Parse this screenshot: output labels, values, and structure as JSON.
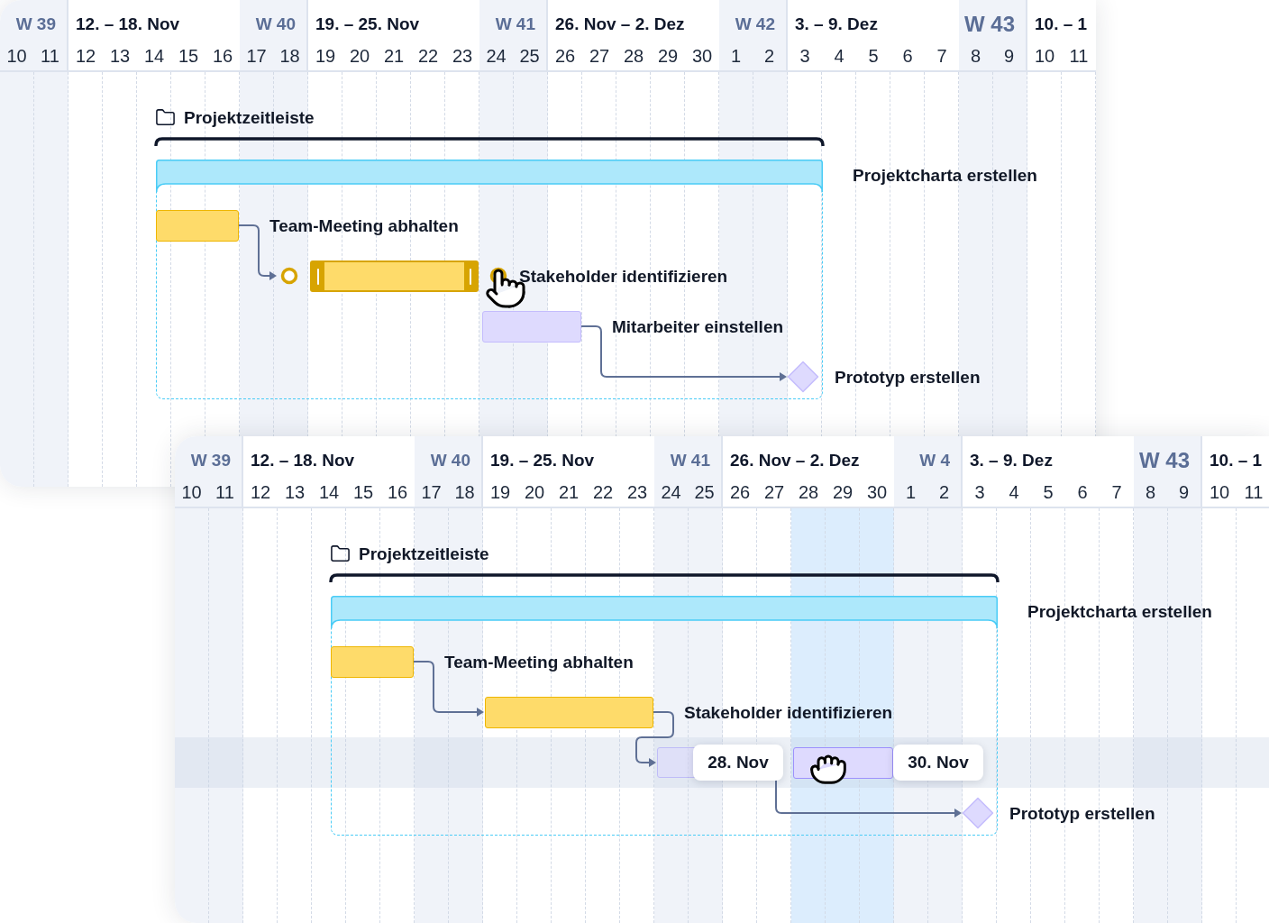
{
  "panels": [
    {
      "weeks": [
        {
          "kind": "weekend",
          "label": "W 39",
          "large": false,
          "days": [
            {
              "label": "10",
              "highlighted": false
            },
            {
              "label": "11",
              "highlighted": false
            }
          ]
        },
        {
          "kind": "weekdays",
          "label": "12. – 18. Nov",
          "large": false,
          "days": [
            {
              "label": "12",
              "highlighted": false
            },
            {
              "label": "13",
              "highlighted": false
            },
            {
              "label": "14",
              "highlighted": false
            },
            {
              "label": "15",
              "highlighted": false
            },
            {
              "label": "16",
              "highlighted": false
            }
          ]
        },
        {
          "kind": "weekend",
          "label": "W 40",
          "large": false,
          "days": [
            {
              "label": "17",
              "highlighted": false
            },
            {
              "label": "18",
              "highlighted": false
            }
          ]
        },
        {
          "kind": "weekdays",
          "label": "19. – 25. Nov",
          "large": false,
          "days": [
            {
              "label": "19",
              "highlighted": false
            },
            {
              "label": "20",
              "highlighted": false
            },
            {
              "label": "21",
              "highlighted": false
            },
            {
              "label": "22",
              "highlighted": false
            },
            {
              "label": "23",
              "highlighted": false
            }
          ]
        },
        {
          "kind": "weekend",
          "label": "W 41",
          "large": false,
          "days": [
            {
              "label": "24",
              "highlighted": false
            },
            {
              "label": "25",
              "highlighted": false
            }
          ]
        },
        {
          "kind": "weekdays",
          "label": "26. Nov – 2. Dez",
          "large": false,
          "days": [
            {
              "label": "26",
              "highlighted": false
            },
            {
              "label": "27",
              "highlighted": false
            },
            {
              "label": "28",
              "highlighted": false
            },
            {
              "label": "29",
              "highlighted": false
            },
            {
              "label": "30",
              "highlighted": false
            }
          ]
        },
        {
          "kind": "weekend",
          "label": "W 42",
          "large": false,
          "days": [
            {
              "label": "1",
              "highlighted": false
            },
            {
              "label": "2",
              "highlighted": false
            }
          ]
        },
        {
          "kind": "weekdays",
          "label": "3. – 9. Dez",
          "large": false,
          "days": [
            {
              "label": "3",
              "highlighted": false
            },
            {
              "label": "4",
              "highlighted": false
            },
            {
              "label": "5",
              "highlighted": false
            },
            {
              "label": "6",
              "highlighted": false
            },
            {
              "label": "7",
              "highlighted": false
            }
          ]
        },
        {
          "kind": "weekend",
          "label": "W 43",
          "large": true,
          "days": [
            {
              "label": "8",
              "highlighted": false
            },
            {
              "label": "9",
              "highlighted": false
            }
          ]
        },
        {
          "kind": "weekdays",
          "label": "10. – 1",
          "large": false,
          "days": [
            {
              "label": "10",
              "highlighted": false
            },
            {
              "label": "11",
              "highlighted": false
            }
          ]
        }
      ],
      "project": {
        "title": "Projektzeitleiste"
      },
      "tasks": [
        {
          "kind": "summary",
          "label": "Projektcharta erstellen",
          "color": "#ade8fb"
        },
        {
          "kind": "task",
          "label": "Team-Meeting abhalten",
          "color": "#fedb6a",
          "selected": false,
          "dragging": false,
          "linked": true
        },
        {
          "kind": "task",
          "label": "Stakeholder identifizieren",
          "color": "#fedb6a",
          "selected": true,
          "dragging": false,
          "linked": false
        },
        {
          "kind": "task",
          "label": "Mitarbeiter einstellen",
          "color": "#dedafe",
          "selected": false,
          "dragging": false,
          "linked": true
        },
        {
          "kind": "milestone",
          "label": "Prototyp erstellen",
          "color": "#dedafe"
        }
      ]
    },
    {
      "weeks": [
        {
          "kind": "weekend",
          "label": "W 39",
          "large": false,
          "days": [
            {
              "label": "10",
              "highlighted": false
            },
            {
              "label": "11",
              "highlighted": false
            }
          ]
        },
        {
          "kind": "weekdays",
          "label": "12. – 18. Nov",
          "large": false,
          "days": [
            {
              "label": "12",
              "highlighted": false
            },
            {
              "label": "13",
              "highlighted": false
            },
            {
              "label": "14",
              "highlighted": false
            },
            {
              "label": "15",
              "highlighted": false
            },
            {
              "label": "16",
              "highlighted": false
            }
          ]
        },
        {
          "kind": "weekend",
          "label": "W 40",
          "large": false,
          "days": [
            {
              "label": "17",
              "highlighted": false
            },
            {
              "label": "18",
              "highlighted": false
            }
          ]
        },
        {
          "kind": "weekdays",
          "label": "19. – 25. Nov",
          "large": false,
          "days": [
            {
              "label": "19",
              "highlighted": false
            },
            {
              "label": "20",
              "highlighted": false
            },
            {
              "label": "21",
              "highlighted": false
            },
            {
              "label": "22",
              "highlighted": false
            },
            {
              "label": "23",
              "highlighted": false
            }
          ]
        },
        {
          "kind": "weekend",
          "label": "W 41",
          "large": false,
          "days": [
            {
              "label": "24",
              "highlighted": false
            },
            {
              "label": "25",
              "highlighted": false
            }
          ]
        },
        {
          "kind": "weekdays",
          "label": "26. Nov – 2. Dez",
          "large": false,
          "days": [
            {
              "label": "26",
              "highlighted": false
            },
            {
              "label": "27",
              "highlighted": false
            },
            {
              "label": "28",
              "highlighted": true
            },
            {
              "label": "29",
              "highlighted": true
            },
            {
              "label": "30",
              "highlighted": true
            }
          ]
        },
        {
          "kind": "weekend",
          "label": "W 4",
          "large": false,
          "days": [
            {
              "label": "1",
              "highlighted": false
            },
            {
              "label": "2",
              "highlighted": false
            }
          ]
        },
        {
          "kind": "weekdays",
          "label": "3. – 9. Dez",
          "large": false,
          "days": [
            {
              "label": "3",
              "highlighted": false
            },
            {
              "label": "4",
              "highlighted": false
            },
            {
              "label": "5",
              "highlighted": false
            },
            {
              "label": "6",
              "highlighted": false
            },
            {
              "label": "7",
              "highlighted": false
            }
          ]
        },
        {
          "kind": "weekend",
          "label": "W 43",
          "large": true,
          "days": [
            {
              "label": "8",
              "highlighted": false
            },
            {
              "label": "9",
              "highlighted": false
            }
          ]
        },
        {
          "kind": "weekdays",
          "label": "10. – 1",
          "large": false,
          "days": [
            {
              "label": "10",
              "highlighted": false
            },
            {
              "label": "11",
              "highlighted": false
            }
          ]
        }
      ],
      "project": {
        "title": "Projektzeitleiste"
      },
      "tasks": [
        {
          "kind": "summary",
          "label": "Projektcharta erstellen",
          "color": "#ade8fb"
        },
        {
          "kind": "task",
          "label": "Team-Meeting abhalten",
          "color": "#fedb6a",
          "selected": false,
          "dragging": false,
          "linked": true
        },
        {
          "kind": "task",
          "label": "Stakeholder identifizieren",
          "color": "#fedb6a",
          "selected": false,
          "dragging": false,
          "linked": true
        },
        {
          "kind": "task",
          "color": "#dedafe",
          "selected": false,
          "dragging": true,
          "start_date": "28. Nov",
          "end_date": "30. Nov",
          "linked": true
        },
        {
          "kind": "milestone",
          "label": "Prototyp erstellen",
          "color": "#dedafe"
        }
      ]
    }
  ]
}
